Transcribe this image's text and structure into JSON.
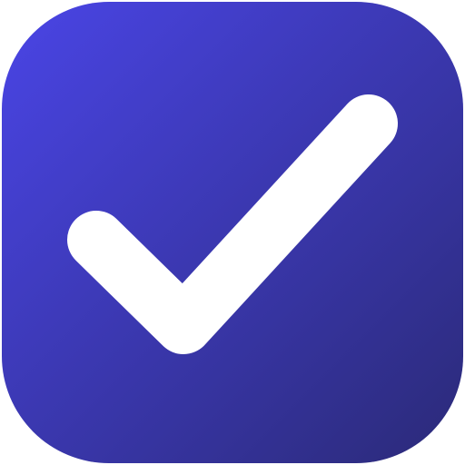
{
  "icon": {
    "name": "checkmark-icon",
    "shape": "rounded-square",
    "colors": {
      "gradient_start": "#4a45e6",
      "gradient_end": "#2b2a78",
      "checkmark": "#ffffff",
      "background": "#ffffff"
    }
  }
}
